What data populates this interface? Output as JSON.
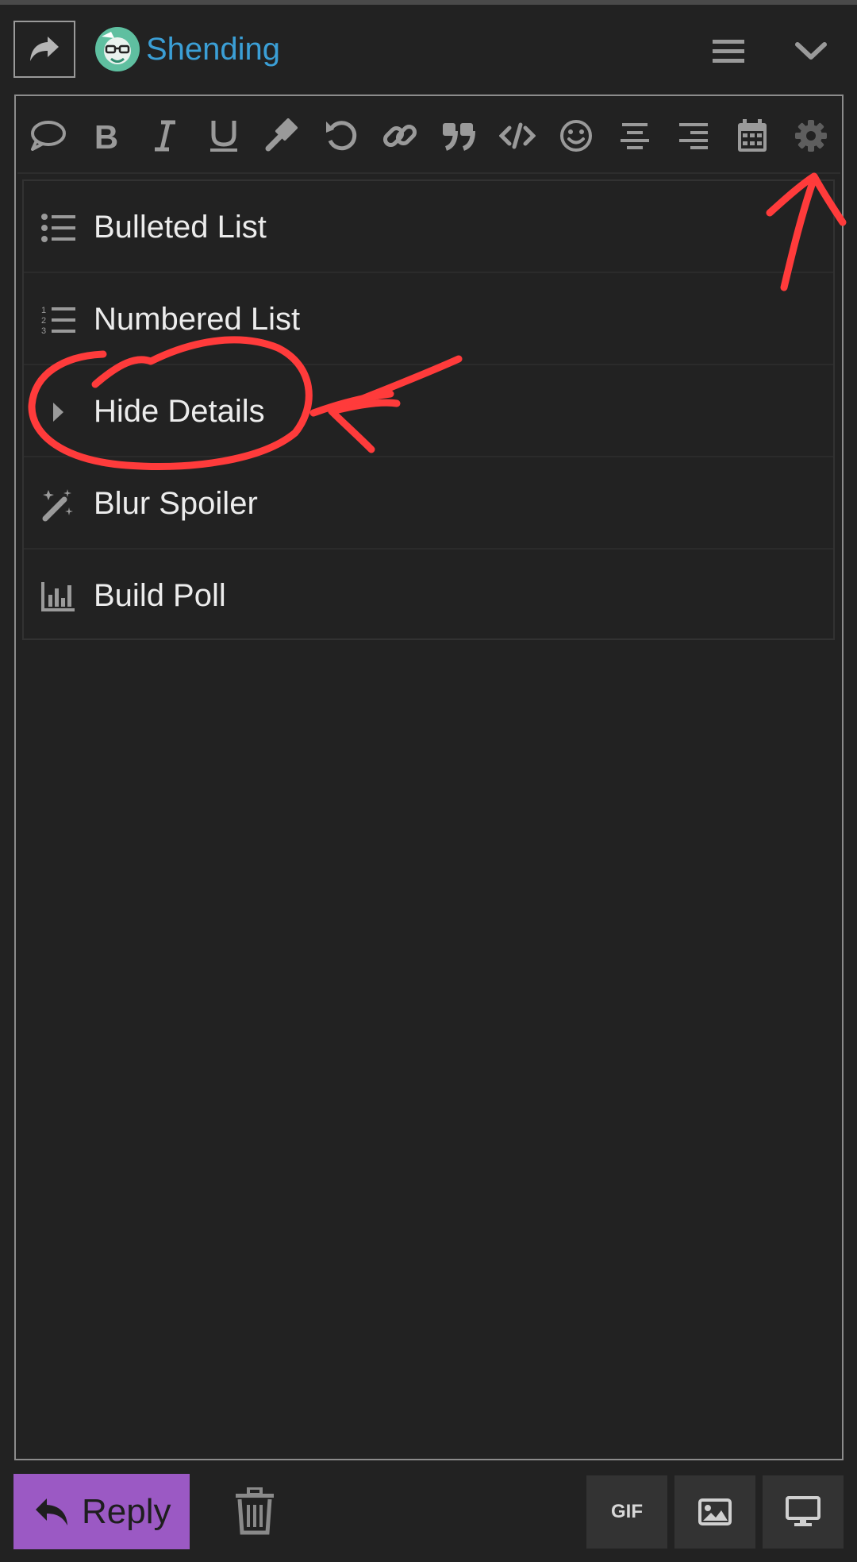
{
  "header": {
    "username": "Shending",
    "reply_icon": "share-arrow-icon",
    "menu_icon": "hamburger-icon",
    "collapse_icon": "chevron-down-icon"
  },
  "toolbar": {
    "buttons": [
      {
        "name": "quote-reply",
        "icon": "speech-bubble-icon"
      },
      {
        "name": "bold",
        "icon": "bold-icon"
      },
      {
        "name": "italic",
        "icon": "italic-icon"
      },
      {
        "name": "underline",
        "icon": "underline-icon"
      },
      {
        "name": "gavel",
        "icon": "gavel-icon"
      },
      {
        "name": "undo",
        "icon": "undo-icon"
      },
      {
        "name": "link",
        "icon": "link-icon"
      },
      {
        "name": "blockquote",
        "icon": "quote-icon"
      },
      {
        "name": "code",
        "icon": "code-icon"
      },
      {
        "name": "emoji",
        "icon": "smile-icon"
      },
      {
        "name": "align-center",
        "icon": "align-center-icon"
      },
      {
        "name": "align-right",
        "icon": "align-right-icon"
      },
      {
        "name": "date",
        "icon": "calendar-icon"
      },
      {
        "name": "options",
        "icon": "gear-icon"
      }
    ]
  },
  "menu": {
    "items": [
      {
        "label": "Bulleted List",
        "icon": "bulleted-list-icon"
      },
      {
        "label": "Numbered List",
        "icon": "numbered-list-icon"
      },
      {
        "label": "Hide Details",
        "icon": "caret-right-icon"
      },
      {
        "label": "Blur Spoiler",
        "icon": "magic-wand-icon"
      },
      {
        "label": "Build Poll",
        "icon": "bar-chart-icon"
      }
    ]
  },
  "footer": {
    "reply_label": "Reply",
    "gif_label": "GIF",
    "trash_icon": "trash-icon",
    "image_icon": "image-icon",
    "preview_icon": "desktop-icon"
  },
  "colors": {
    "background": "#222222",
    "username": "#3b9fd6",
    "reply_button": "#9b59c4",
    "icon": "#9a9a9a",
    "annotation": "#ff3b3b"
  }
}
